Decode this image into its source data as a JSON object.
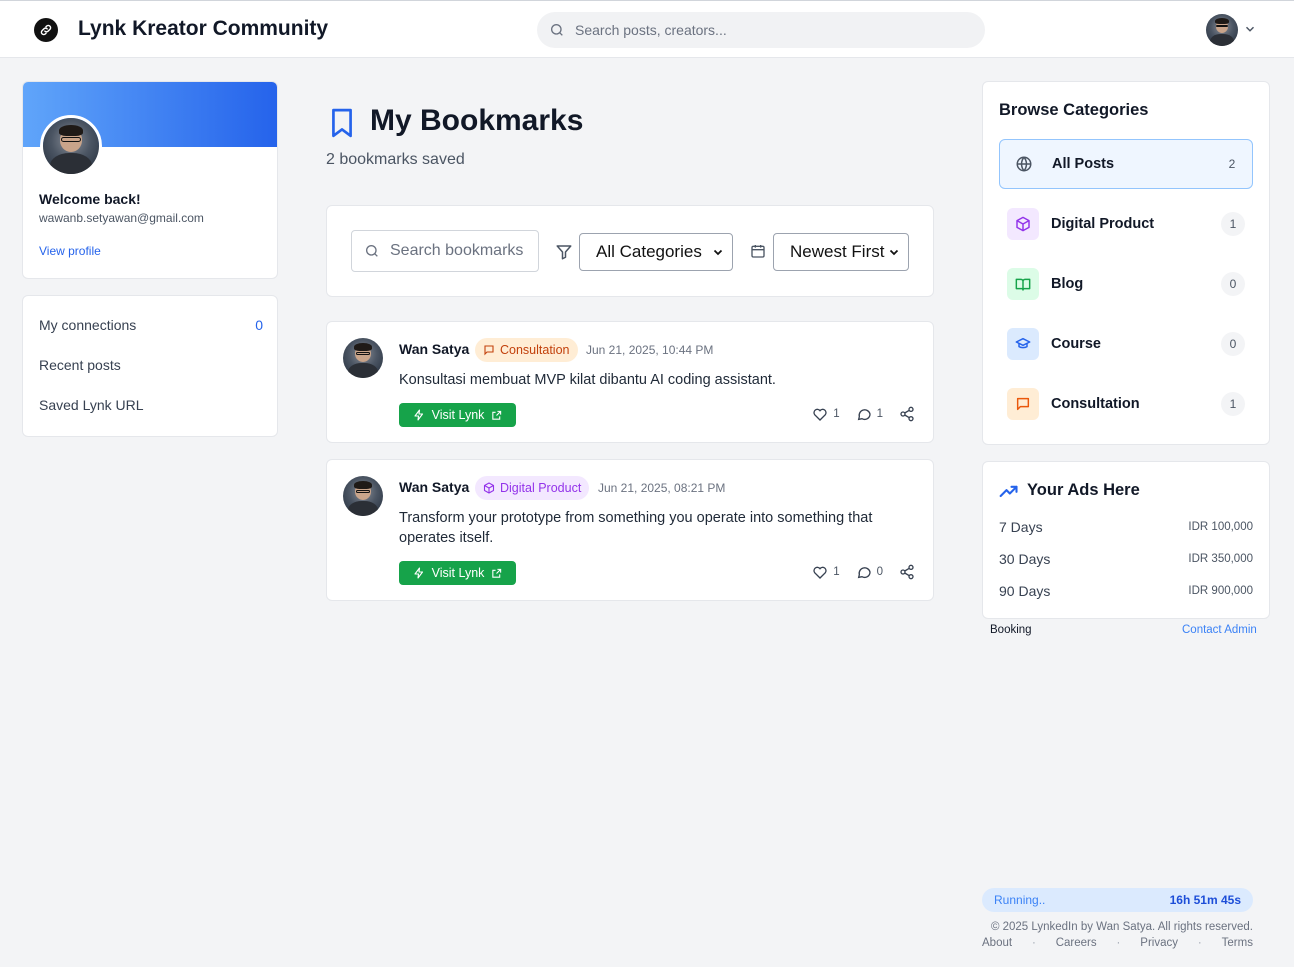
{
  "header": {
    "brand": "Lynk Kreator Community",
    "search_placeholder": "Search posts, creators..."
  },
  "profile": {
    "welcome": "Welcome back!",
    "email": "wawanb.setyawan@gmail.com",
    "view_profile": "View profile"
  },
  "nav": {
    "connections_label": "My connections",
    "connections_count": "0",
    "recent_posts": "Recent posts",
    "saved_url": "Saved Lynk URL"
  },
  "main": {
    "title": "My Bookmarks",
    "subtitle": "2 bookmarks saved",
    "search_placeholder": "Search bookmarks",
    "category_select": "All Categories",
    "sort_select": "Newest First"
  },
  "posts": [
    {
      "author": "Wan Satya",
      "badge": "Consultation",
      "date": "Jun 21, 2025, 10:44 PM",
      "text": "Konsultasi membuat MVP kilat dibantu AI coding assistant.",
      "visit": "Visit Lynk",
      "likes": "1",
      "comments": "1"
    },
    {
      "author": "Wan Satya",
      "badge": "Digital Product",
      "date": "Jun 21, 2025, 08:21 PM",
      "text": "Transform your prototype from something you operate into something that operates itself.",
      "visit": "Visit Lynk",
      "likes": "1",
      "comments": "0"
    }
  ],
  "categories": {
    "title": "Browse Categories",
    "items": [
      {
        "name": "All Posts",
        "count": "2",
        "icon": "globe-icon"
      },
      {
        "name": "Digital Product",
        "count": "1",
        "icon": "box-icon"
      },
      {
        "name": "Blog",
        "count": "0",
        "icon": "book-icon"
      },
      {
        "name": "Course",
        "count": "0",
        "icon": "graduation-cap-icon"
      },
      {
        "name": "Consultation",
        "count": "1",
        "icon": "message-square-icon"
      }
    ]
  },
  "ads": {
    "title": "Your Ads Here",
    "rows": [
      {
        "duration": "7 Days",
        "price": "IDR 100,000"
      },
      {
        "duration": "30 Days",
        "price": "IDR 350,000"
      },
      {
        "duration": "90 Days",
        "price": "IDR 900,000"
      }
    ],
    "booking": "Booking",
    "contact": "Contact Admin"
  },
  "footer": {
    "running": "Running..",
    "timer": "16h 51m 45s",
    "copyright": "© 2025 LynkedIn by Wan Satya. All rights reserved.",
    "about": "About",
    "careers": "Careers",
    "privacy": "Privacy",
    "terms": "Terms",
    "sep": "·"
  },
  "colors": {
    "accent": "#2563eb",
    "visit_green": "#16a34a",
    "consult_orange": "#c2410c",
    "digital_purple": "#9333ea"
  }
}
